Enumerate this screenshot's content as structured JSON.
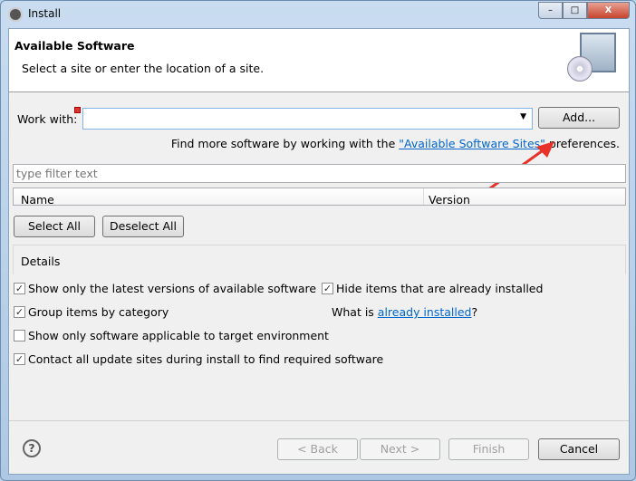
{
  "window": {
    "title": "Install",
    "minimize": "–",
    "maximize": "□",
    "close": "X"
  },
  "header": {
    "title": "Available Software",
    "subtitle": "Select a site or enter the location of a site."
  },
  "work_with": {
    "label": "Work with:",
    "value": "",
    "add_label": "Add..."
  },
  "find_more": {
    "prefix": "Find more software by working with the ",
    "link": "\"Available Software Sites\"",
    "suffix": " preferences."
  },
  "filter": {
    "placeholder": "type filter text"
  },
  "table": {
    "columns": [
      "Name",
      "Version"
    ]
  },
  "buttons": {
    "select_all": "Select All",
    "deselect_all": "Deselect All"
  },
  "details": {
    "label": "Details"
  },
  "options": [
    {
      "label": "Show only the latest versions of available software",
      "checked": true
    },
    {
      "label": "Hide items that are already installed",
      "checked": true
    },
    {
      "label": "Group items by category",
      "checked": true
    },
    {
      "label": "Show only software applicable to target environment",
      "checked": false
    },
    {
      "label": "Contact all update sites during install to find required software",
      "checked": true
    }
  ],
  "already": {
    "prefix": "What is ",
    "link": "already installed",
    "suffix": "?"
  },
  "footer": {
    "help": "?",
    "back": "< Back",
    "next": "Next >",
    "finish": "Finish",
    "cancel": "Cancel"
  }
}
